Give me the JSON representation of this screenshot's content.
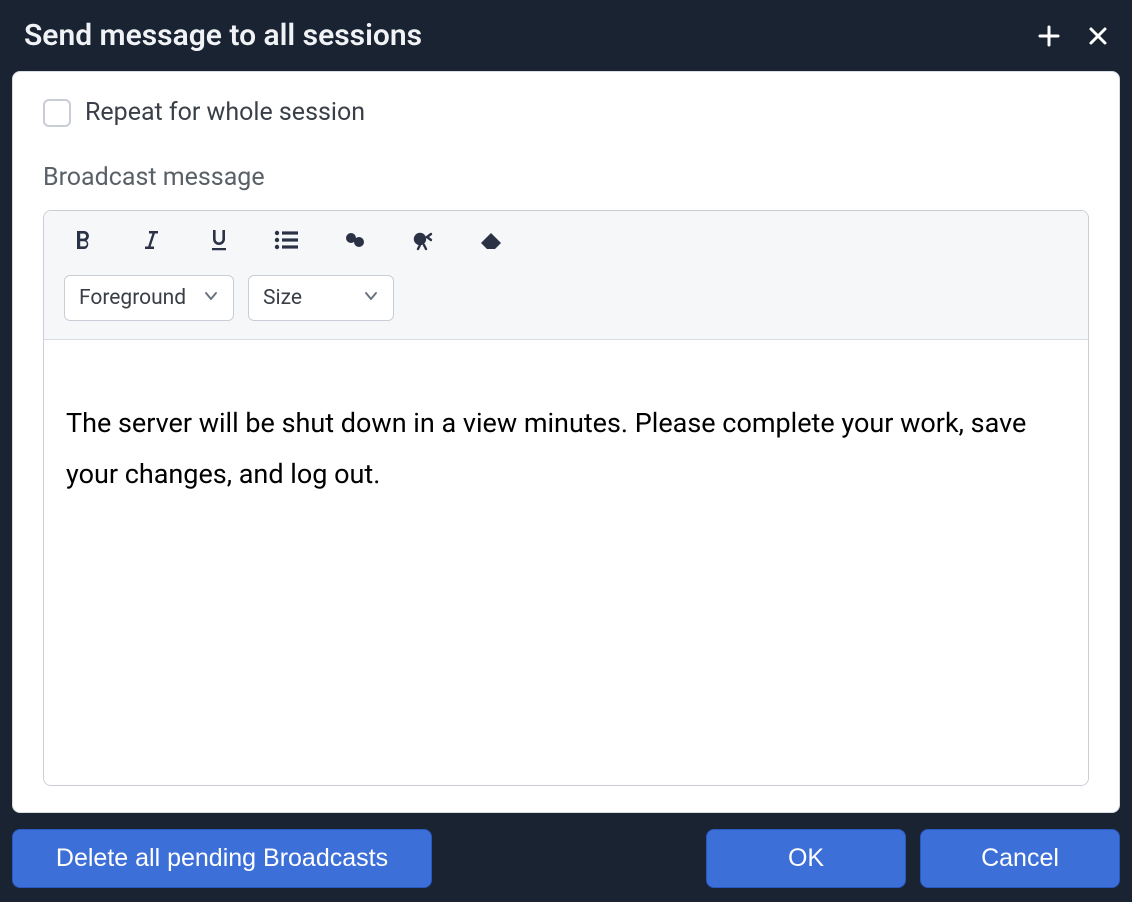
{
  "dialog": {
    "title": "Send message to all sessions"
  },
  "form": {
    "repeat_checkbox_label": "Repeat for whole session",
    "repeat_checked": false,
    "broadcast_label": "Broadcast message"
  },
  "editor": {
    "dropdowns": {
      "foreground_label": "Foreground",
      "size_label": "Size"
    },
    "content": "The server will be shut down in a view minutes. Please complete your work, save your changes, and log out."
  },
  "footer": {
    "delete_label": "Delete all pending Broadcasts",
    "ok_label": "OK",
    "cancel_label": "Cancel"
  }
}
